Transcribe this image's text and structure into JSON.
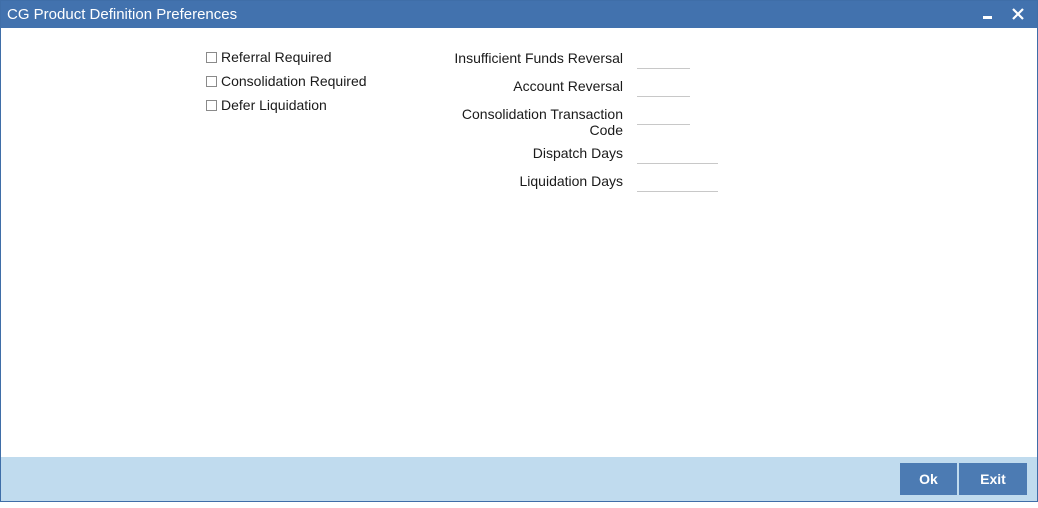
{
  "window": {
    "title": "CG Product Definition Preferences",
    "minimize_icon": "minimize-icon",
    "close_icon": "close-icon"
  },
  "checkboxes": [
    {
      "label": "Referral Required",
      "checked": false
    },
    {
      "label": "Consolidation Required",
      "checked": false
    },
    {
      "label": "Defer Liquidation",
      "checked": false
    }
  ],
  "fields": {
    "insufficient_funds_reversal": {
      "label": "Insufficient Funds Reversal",
      "value": ""
    },
    "account_reversal": {
      "label": "Account Reversal",
      "value": ""
    },
    "consolidation_transaction_code": {
      "label_line1": "Consolidation Transaction",
      "label_line2": "Code",
      "value": ""
    },
    "dispatch_days": {
      "label": "Dispatch Days",
      "value": ""
    },
    "liquidation_days": {
      "label": "Liquidation Days",
      "value": ""
    }
  },
  "footer": {
    "ok_label": "Ok",
    "exit_label": "Exit"
  },
  "colors": {
    "titlebar": "#4272ae",
    "footer": "#c0dbee",
    "button": "#4c7bb3"
  }
}
